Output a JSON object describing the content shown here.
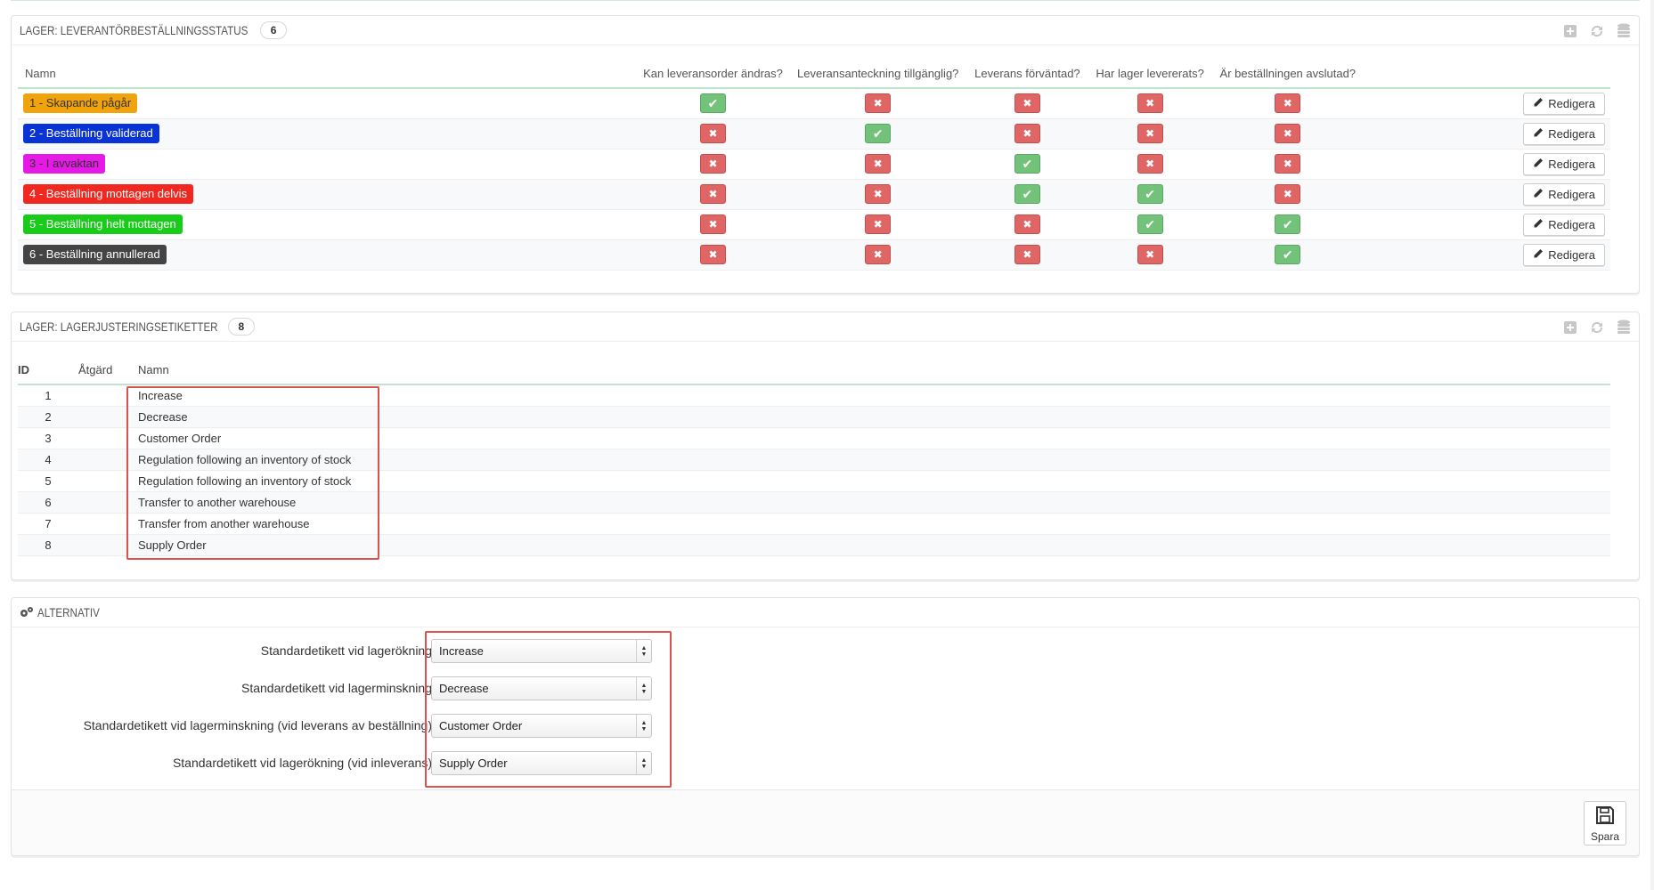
{
  "status_panel": {
    "title": "LAGER: LEVERANTÖRBESTÄLLNINGSSTATUS",
    "count": "6",
    "columns": [
      "Namn",
      "Kan leveransorder ändras?",
      "Leveransanteckning tillgänglig?",
      "Leverans förväntad?",
      "Har lager levererats?",
      "Är beställningen avslutad?"
    ],
    "edit_label": "Redigera",
    "rows": [
      {
        "name": "1 - Skapande pågår",
        "color": "#f0a30a",
        "dark_text": true,
        "flags": [
          true,
          false,
          false,
          false,
          false
        ]
      },
      {
        "name": "2 - Beställning validerad",
        "color": "#0a33d6",
        "dark_text": false,
        "flags": [
          false,
          true,
          false,
          false,
          false
        ]
      },
      {
        "name": "3 - I avvaktan",
        "color": "#e619e6",
        "dark_text": true,
        "flags": [
          false,
          false,
          true,
          false,
          false
        ]
      },
      {
        "name": "4 - Beställning mottagen delvis",
        "color": "#f0281f",
        "dark_text": false,
        "flags": [
          false,
          false,
          true,
          true,
          false
        ]
      },
      {
        "name": "5 - Beställning helt mottagen",
        "color": "#19cc19",
        "dark_text": false,
        "flags": [
          false,
          false,
          false,
          true,
          true
        ]
      },
      {
        "name": "6 - Beställning annullerad",
        "color": "#444444",
        "dark_text": false,
        "flags": [
          false,
          false,
          false,
          false,
          true
        ]
      }
    ]
  },
  "labels_panel": {
    "title": "LAGER: LAGERJUSTERINGSETIKETTER",
    "count": "8",
    "columns": [
      "ID",
      "Åtgärd",
      "Namn"
    ],
    "rows": [
      {
        "id": "1",
        "name": "Increase"
      },
      {
        "id": "2",
        "name": "Decrease"
      },
      {
        "id": "3",
        "name": "Customer Order"
      },
      {
        "id": "4",
        "name": "Regulation following an inventory of stock"
      },
      {
        "id": "5",
        "name": "Regulation following an inventory of stock"
      },
      {
        "id": "6",
        "name": "Transfer to another warehouse"
      },
      {
        "id": "7",
        "name": "Transfer from another warehouse"
      },
      {
        "id": "8",
        "name": "Supply Order"
      }
    ]
  },
  "options_panel": {
    "title": "ALTERNATIV",
    "fields": [
      {
        "label": "Standardetikett vid lagerökning",
        "value": "Increase"
      },
      {
        "label": "Standardetikett vid lagerminskning",
        "value": "Decrease"
      },
      {
        "label": "Standardetikett vid lagerminskning (vid leverans av beställning)",
        "value": "Customer Order"
      },
      {
        "label": "Standardetikett vid lagerökning (vid inleverans)",
        "value": "Supply Order"
      }
    ],
    "save_label": "Spara"
  },
  "icons": {
    "add": "add-icon",
    "refresh": "refresh-icon",
    "database": "database-icon",
    "edit": "pencil-icon",
    "options": "gears-icon",
    "save": "floppy-disk-icon",
    "yes": "check-icon",
    "no": "cross-icon"
  },
  "colors": {
    "yes": "#72c279",
    "no": "#e06666",
    "highlight": "#d9534f"
  }
}
